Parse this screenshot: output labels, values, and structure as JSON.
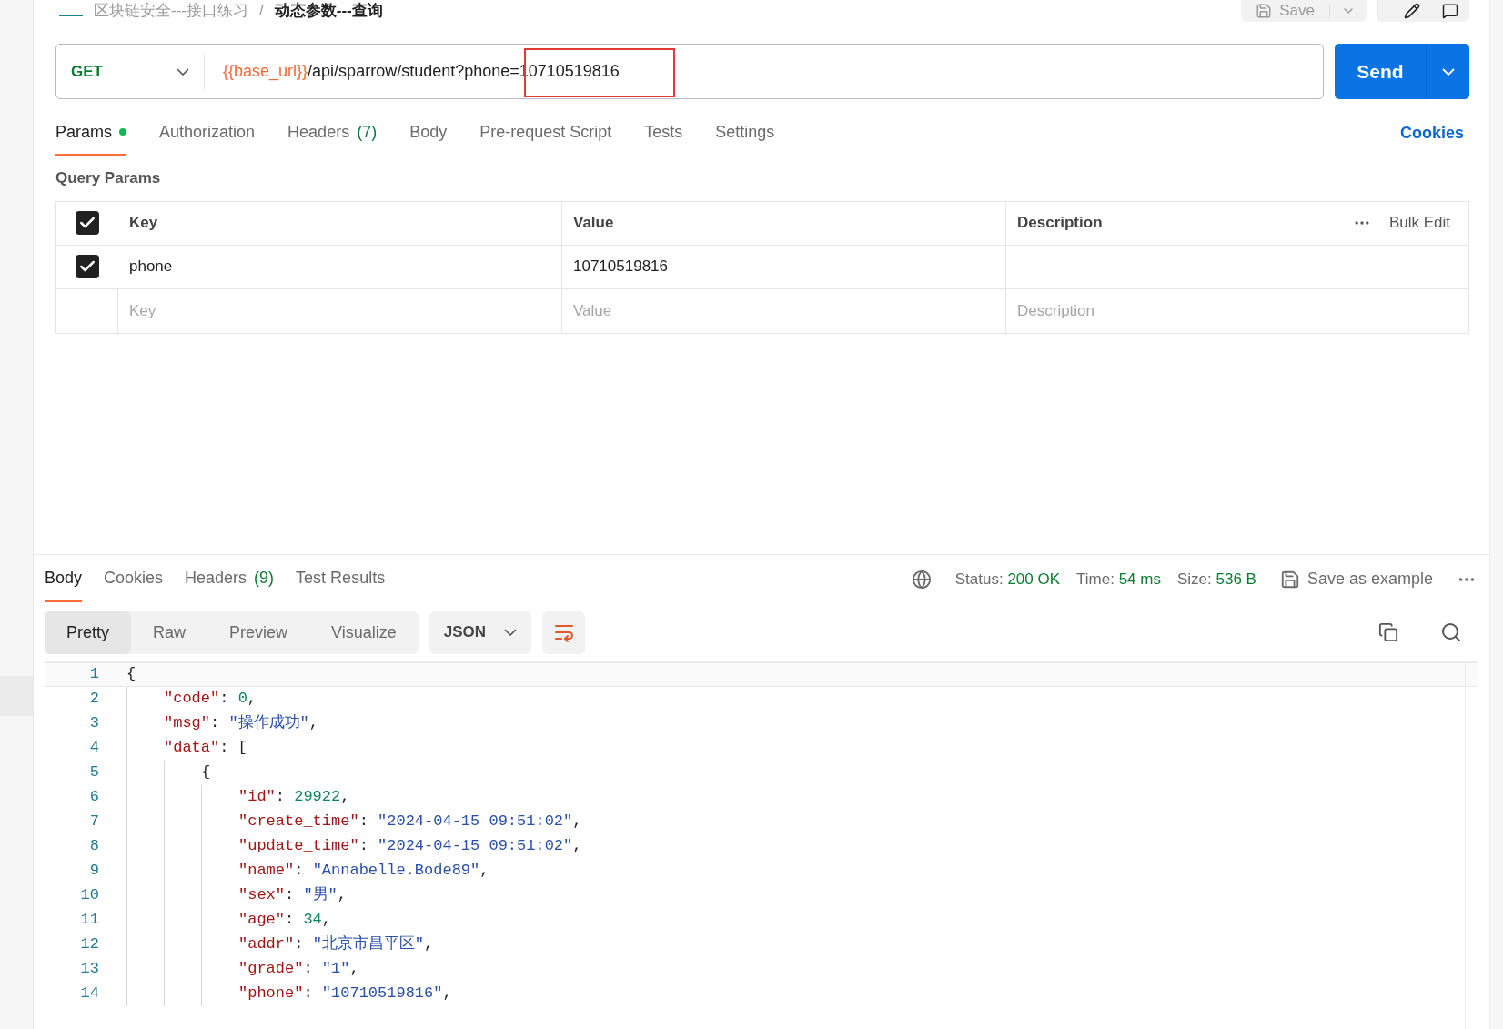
{
  "breadcrumb": {
    "collection": "区块链安全---接口练习",
    "separator": "/",
    "request": "动态参数---查询"
  },
  "top_actions": {
    "save": "Save"
  },
  "request": {
    "method": "GET",
    "url_variable": "{{base_url}}",
    "url_path": "/api/sparrow/student?phone=10710519816",
    "send": "Send"
  },
  "request_tabs": [
    {
      "label": "Params",
      "selected": true,
      "dot": true
    },
    {
      "label": "Authorization",
      "selected": false,
      "dot": false
    },
    {
      "label": "Headers",
      "count": "(7)",
      "selected": false,
      "dot": false
    },
    {
      "label": "Body",
      "selected": false,
      "dot": false
    },
    {
      "label": "Pre-request Script",
      "selected": false,
      "dot": false
    },
    {
      "label": "Tests",
      "selected": false,
      "dot": false
    },
    {
      "label": "Settings",
      "selected": false,
      "dot": false
    }
  ],
  "cookies_link": "Cookies",
  "query_params": {
    "title": "Query Params",
    "columns": [
      "Key",
      "Value",
      "Description"
    ],
    "header_checked": true,
    "bulk_edit": "Bulk Edit",
    "rows": [
      {
        "key": "phone",
        "value": "10710519816",
        "checked": true
      }
    ],
    "empty_row": [
      {
        "placeholder": "Key"
      },
      {
        "placeholder": "Value"
      },
      {
        "placeholder": "Description"
      }
    ]
  },
  "response_tabs": [
    {
      "label": "Body",
      "selected": true
    },
    {
      "label": "Cookies",
      "selected": false
    },
    {
      "label": "Headers",
      "count": "(9)",
      "selected": false
    },
    {
      "label": "Test Results",
      "selected": false
    }
  ],
  "status": [
    {
      "label": "Status:",
      "value": "200 OK"
    },
    {
      "label": "Time:",
      "value": "54 ms"
    },
    {
      "label": "Size:",
      "value": "536 B"
    }
  ],
  "save_example": "Save as example",
  "view_modes": [
    {
      "label": "Pretty",
      "selected": true
    },
    {
      "label": "Raw",
      "selected": false
    },
    {
      "label": "Preview",
      "selected": false
    },
    {
      "label": "Visualize",
      "selected": false
    }
  ],
  "format": "JSON",
  "wrap_on": true,
  "code": [
    {
      "n": "1",
      "tokens": [
        {
          "kind": "punct",
          "s": "{"
        }
      ]
    },
    {
      "n": "2",
      "tokens": [
        {
          "kind": "key",
          "s": "    \"code\""
        },
        {
          "kind": "punct",
          "s": ": "
        },
        {
          "kind": "number",
          "s": "0"
        },
        {
          "kind": "punct",
          "s": ","
        }
      ]
    },
    {
      "n": "3",
      "tokens": [
        {
          "kind": "key",
          "s": "    \"msg\""
        },
        {
          "kind": "punct",
          "s": ": "
        },
        {
          "kind": "string",
          "s": "\"操作成功\""
        },
        {
          "kind": "punct",
          "s": ","
        }
      ]
    },
    {
      "n": "4",
      "tokens": [
        {
          "kind": "key",
          "s": "    \"data\""
        },
        {
          "kind": "punct",
          "s": ": ["
        }
      ]
    },
    {
      "n": "5",
      "tokens": [
        {
          "kind": "punct",
          "s": "        {"
        }
      ]
    },
    {
      "n": "6",
      "tokens": [
        {
          "kind": "key",
          "s": "            \"id\""
        },
        {
          "kind": "punct",
          "s": ": "
        },
        {
          "kind": "number",
          "s": "29922"
        },
        {
          "kind": "punct",
          "s": ","
        }
      ]
    },
    {
      "n": "7",
      "tokens": [
        {
          "kind": "key",
          "s": "            \"create_time\""
        },
        {
          "kind": "punct",
          "s": ": "
        },
        {
          "kind": "string",
          "s": "\"2024-04-15 09:51:02\""
        },
        {
          "kind": "punct",
          "s": ","
        }
      ]
    },
    {
      "n": "8",
      "tokens": [
        {
          "kind": "key",
          "s": "            \"update_time\""
        },
        {
          "kind": "punct",
          "s": ": "
        },
        {
          "kind": "string",
          "s": "\"2024-04-15 09:51:02\""
        },
        {
          "kind": "punct",
          "s": ","
        }
      ]
    },
    {
      "n": "9",
      "tokens": [
        {
          "kind": "key",
          "s": "            \"name\""
        },
        {
          "kind": "punct",
          "s": ": "
        },
        {
          "kind": "string",
          "s": "\"Annabelle.Bode89\""
        },
        {
          "kind": "punct",
          "s": ","
        }
      ]
    },
    {
      "n": "10",
      "tokens": [
        {
          "kind": "key",
          "s": "            \"sex\""
        },
        {
          "kind": "punct",
          "s": ": "
        },
        {
          "kind": "string",
          "s": "\"男\""
        },
        {
          "kind": "punct",
          "s": ","
        }
      ]
    },
    {
      "n": "11",
      "tokens": [
        {
          "kind": "key",
          "s": "            \"age\""
        },
        {
          "kind": "punct",
          "s": ": "
        },
        {
          "kind": "number",
          "s": "34"
        },
        {
          "kind": "punct",
          "s": ","
        }
      ]
    },
    {
      "n": "12",
      "tokens": [
        {
          "kind": "key",
          "s": "            \"addr\""
        },
        {
          "kind": "punct",
          "s": ": "
        },
        {
          "kind": "string",
          "s": "\"北京市昌平区\""
        },
        {
          "kind": "punct",
          "s": ","
        }
      ]
    },
    {
      "n": "13",
      "tokens": [
        {
          "kind": "key",
          "s": "            \"grade\""
        },
        {
          "kind": "punct",
          "s": ": "
        },
        {
          "kind": "string",
          "s": "\"1\""
        },
        {
          "kind": "punct",
          "s": ","
        }
      ]
    },
    {
      "n": "14",
      "tokens": [
        {
          "kind": "key",
          "s": "            \"phone\""
        },
        {
          "kind": "punct",
          "s": ": "
        },
        {
          "kind": "string",
          "s": "\"10710519816\""
        },
        {
          "kind": "punct",
          "s": ","
        }
      ]
    }
  ]
}
